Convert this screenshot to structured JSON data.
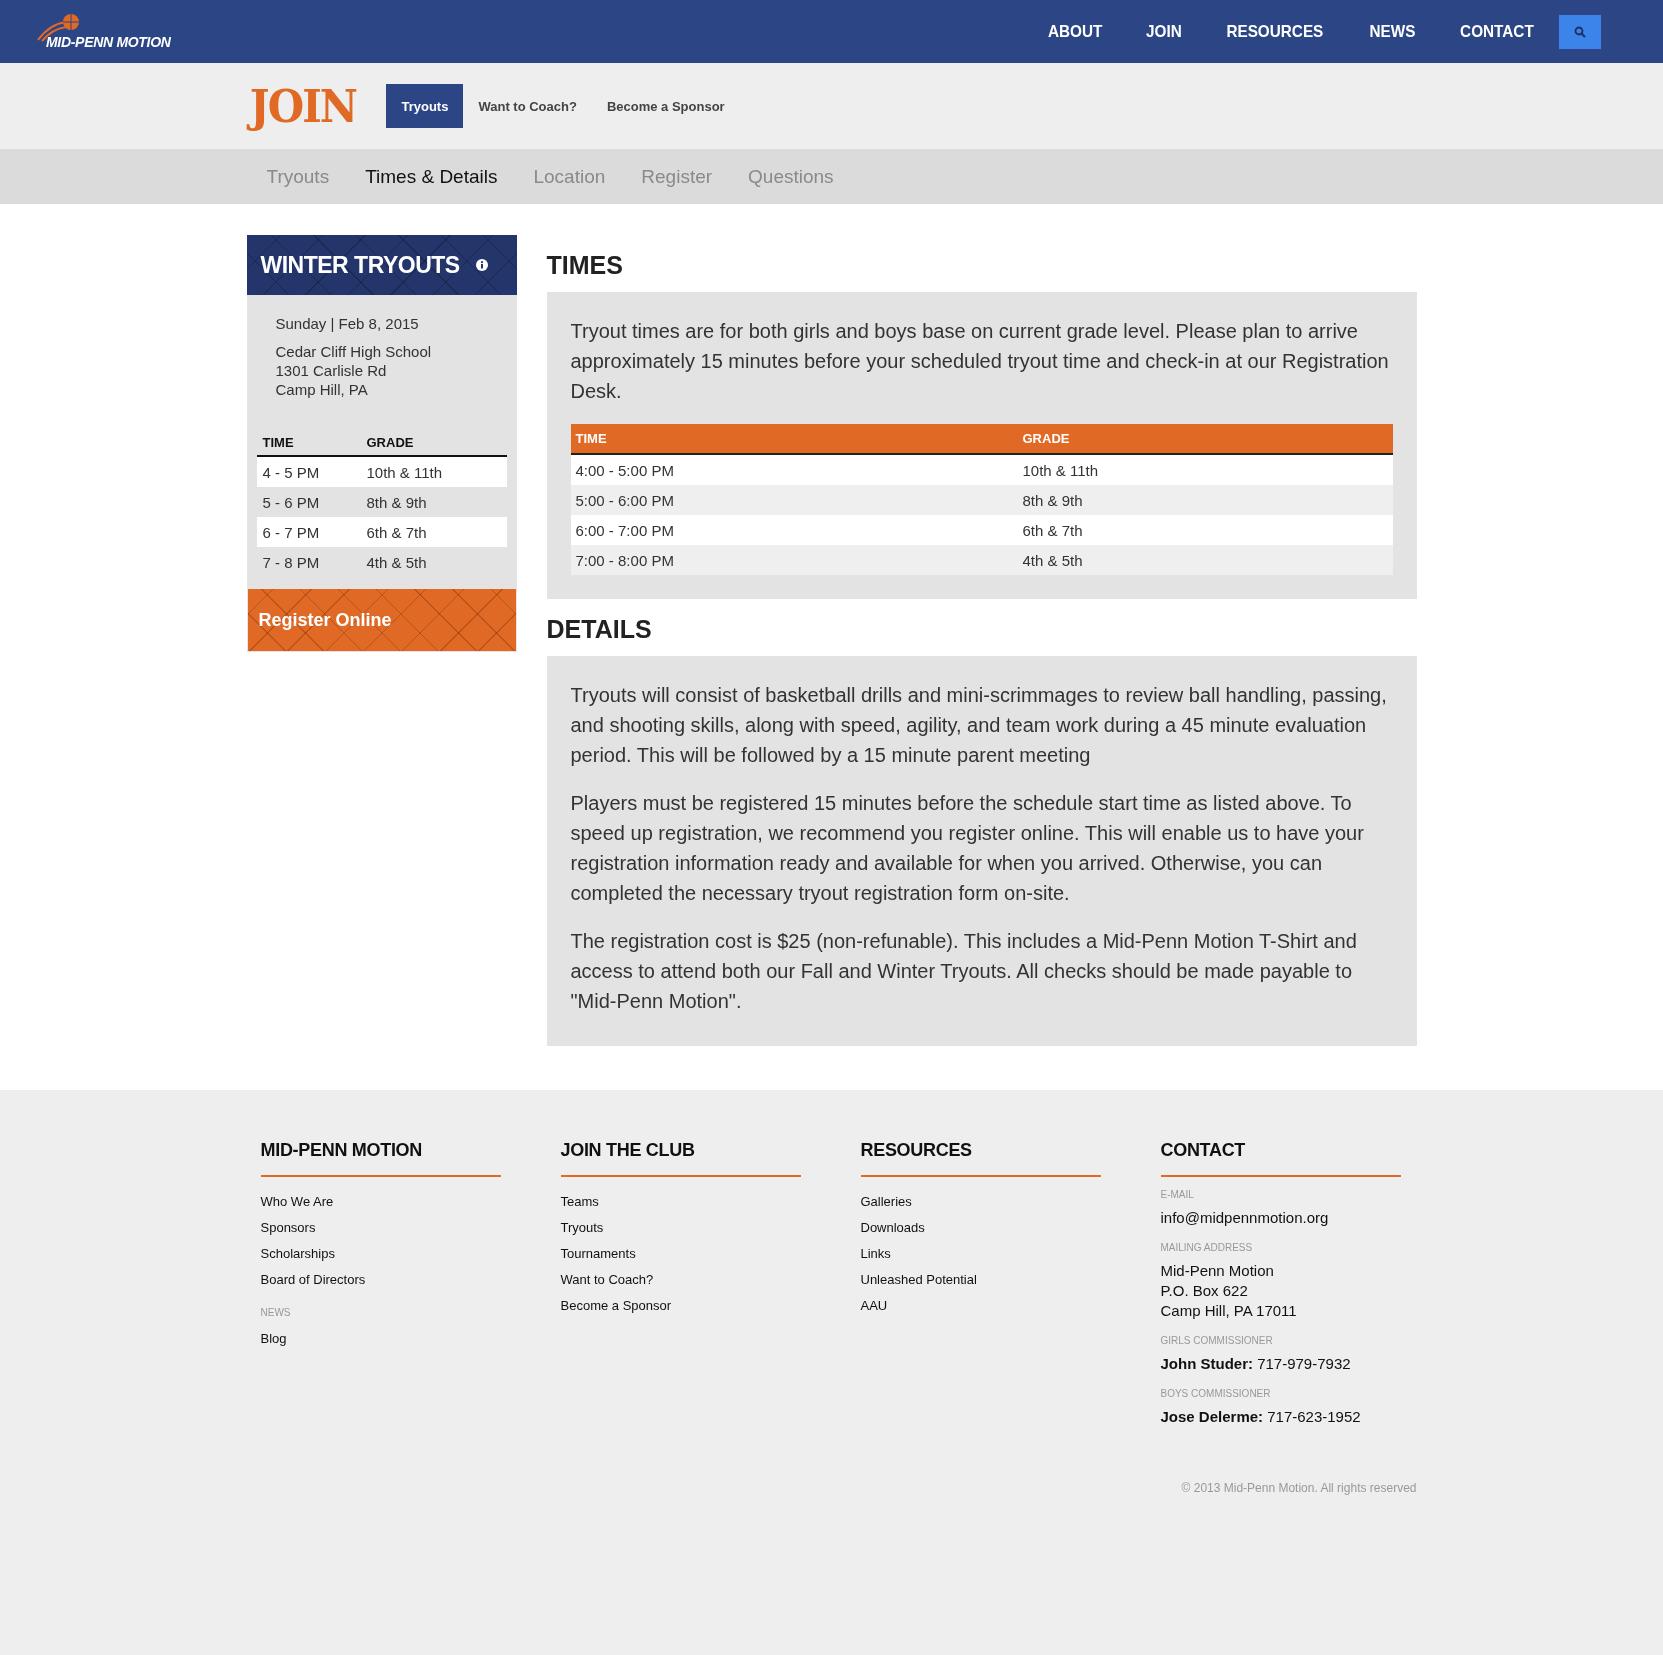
{
  "header": {
    "logo_text": "MID-PENN MOTION",
    "nav": [
      "ABOUT",
      "JOIN",
      "RESOURCES",
      "NEWS",
      "CONTACT"
    ]
  },
  "section": {
    "title": "JOIN",
    "tabs": [
      {
        "label": "Tryouts",
        "selected": true
      },
      {
        "label": "Want to Coach?",
        "selected": false
      },
      {
        "label": "Become a Sponsor",
        "selected": false
      }
    ]
  },
  "subnav": [
    {
      "label": "Tryouts",
      "selected": false
    },
    {
      "label": "Times & Details",
      "selected": true
    },
    {
      "label": "Location",
      "selected": false
    },
    {
      "label": "Register",
      "selected": false
    },
    {
      "label": "Questions",
      "selected": false
    }
  ],
  "sidebar": {
    "title": "WINTER TRYOUTS",
    "date": "Sunday | Feb 8, 2015",
    "address": [
      "Cedar Cliff High School",
      "1301 Carlisle Rd",
      "Camp Hill, PA"
    ],
    "columns": [
      "TIME",
      "GRADE"
    ],
    "rows": [
      [
        "4 - 5 PM",
        "10th & 11th"
      ],
      [
        "5 - 6 PM",
        "8th & 9th"
      ],
      [
        "6 - 7 PM",
        "6th & 7th"
      ],
      [
        "7 - 8 PM",
        "4th & 5th"
      ]
    ],
    "button": "Register Online"
  },
  "times": {
    "title": "TIMES",
    "intro": "Tryout times are for both girls and boys base on current grade level. Please plan to arrive approximately 15 minutes before your scheduled tryout time and check-in at our Registration Desk.",
    "columns": [
      "TIME",
      "GRADE"
    ],
    "rows": [
      [
        "4:00 - 5:00 PM",
        "10th & 11th"
      ],
      [
        "5:00 - 6:00 PM",
        "8th & 9th"
      ],
      [
        "6:00 - 7:00 PM",
        "6th & 7th"
      ],
      [
        "7:00 - 8:00 PM",
        "4th & 5th"
      ]
    ]
  },
  "details": {
    "title": "DETAILS",
    "paragraphs": [
      "Tryouts will consist of basketball drills and mini-scrimmages to review ball handling, passing, and shooting skills, along with speed, agility, and team work during a 45 minute evaluation period. This will be followed by a 15 minute parent meeting",
      "Players must be registered 15 minutes before the schedule start time as listed above. To speed up registration, we recommend you register online. This will enable us to have your registration information ready and available for when you arrived. Otherwise, you can completed the necessary tryout registration form on-site.",
      "The registration cost is $25 (non-refunable). This includes a Mid-Penn Motion T-Shirt and access to attend both our Fall and Winter Tryouts. All checks should be made payable to \"Mid-Penn Motion\"."
    ]
  },
  "footer": {
    "columns": [
      {
        "heading": "MID-PENN MOTION",
        "groups": [
          {
            "links": [
              "Who We Are",
              "Sponsors",
              "Scholarships",
              "Board of Directors"
            ]
          },
          {
            "label": "NEWS",
            "links": [
              "Blog"
            ]
          }
        ]
      },
      {
        "heading": "JOIN THE CLUB",
        "groups": [
          {
            "links": [
              "Teams",
              "Tryouts",
              "Tournaments",
              "Want to Coach?",
              "Become a Sponsor"
            ]
          }
        ]
      },
      {
        "heading": "RESOURCES",
        "groups": [
          {
            "links": [
              "Galleries",
              "Downloads",
              "Links",
              "Unleashed Potential",
              "AAU"
            ]
          }
        ]
      },
      {
        "heading": "CONTACT",
        "contacts": [
          {
            "label": "E-MAIL",
            "lines": [
              "info@midpennmotion.org"
            ]
          },
          {
            "label": "MAILING ADDRESS",
            "lines": [
              "Mid-Penn Motion",
              "P.O. Box 622",
              "Camp Hill, PA 17011"
            ]
          },
          {
            "label": "GIRLS COMMISSIONER",
            "lines": [
              "**John Studer:** 717-979-7932"
            ]
          },
          {
            "label": "BOYS COMMISSIONER",
            "lines": [
              "**Jose Delerme:** 717-623-1952"
            ]
          }
        ]
      }
    ],
    "copyright": "© 2013 Mid-Penn Motion. All rights reserved"
  }
}
